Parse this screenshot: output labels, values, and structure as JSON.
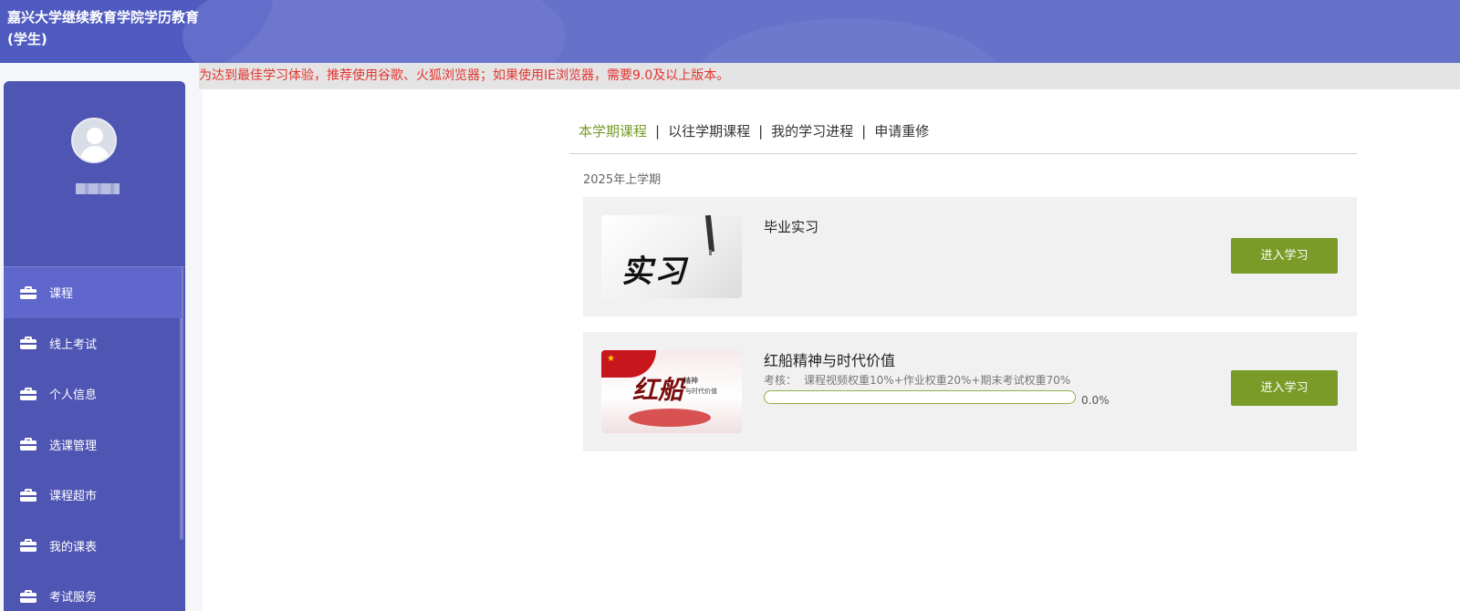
{
  "header": {
    "title": "嘉兴大学继续教育学院学历教育(学生)"
  },
  "notice": {
    "text": "为达到最佳学习体验，推荐使用谷歌、火狐浏览器；如果使用IE浏览器，需要9.0及以上版本。"
  },
  "sidebar": {
    "items": [
      {
        "label": "课程",
        "icon": "briefcase-icon",
        "active": true
      },
      {
        "label": "线上考试",
        "icon": "briefcase-icon"
      },
      {
        "label": "个人信息",
        "icon": "briefcase-icon"
      },
      {
        "label": "选课管理",
        "icon": "briefcase-icon"
      },
      {
        "label": "课程超市",
        "icon": "briefcase-icon"
      },
      {
        "label": "我的课表",
        "icon": "briefcase-icon"
      },
      {
        "label": "考试服务",
        "icon": "briefcase-icon"
      }
    ]
  },
  "tabs": [
    {
      "label": "本学期课程",
      "active": true
    },
    {
      "label": "以往学期课程"
    },
    {
      "label": "我的学习进程"
    },
    {
      "label": "申请重修"
    }
  ],
  "separator": "|",
  "term": "2025年上学期",
  "courses": [
    {
      "name": "毕业实习",
      "thumb_text": "实习",
      "button": "进入学习"
    },
    {
      "name": "红船精神与时代价值",
      "thumb_text": "红船",
      "thumb_sub": "精神",
      "thumb_sub2": "与时代价值",
      "assess_label": "考核：",
      "assess_text": "课程视频权重10%+作业权重20%+期末考试权重70%",
      "progress": 0.0,
      "progress_text": "0.0%",
      "button": "进入学习"
    }
  ],
  "colors": {
    "accent": "#7b9b28",
    "sidebar": "#4f55b3",
    "header": "#6672c9",
    "notice": "#e3342f"
  }
}
